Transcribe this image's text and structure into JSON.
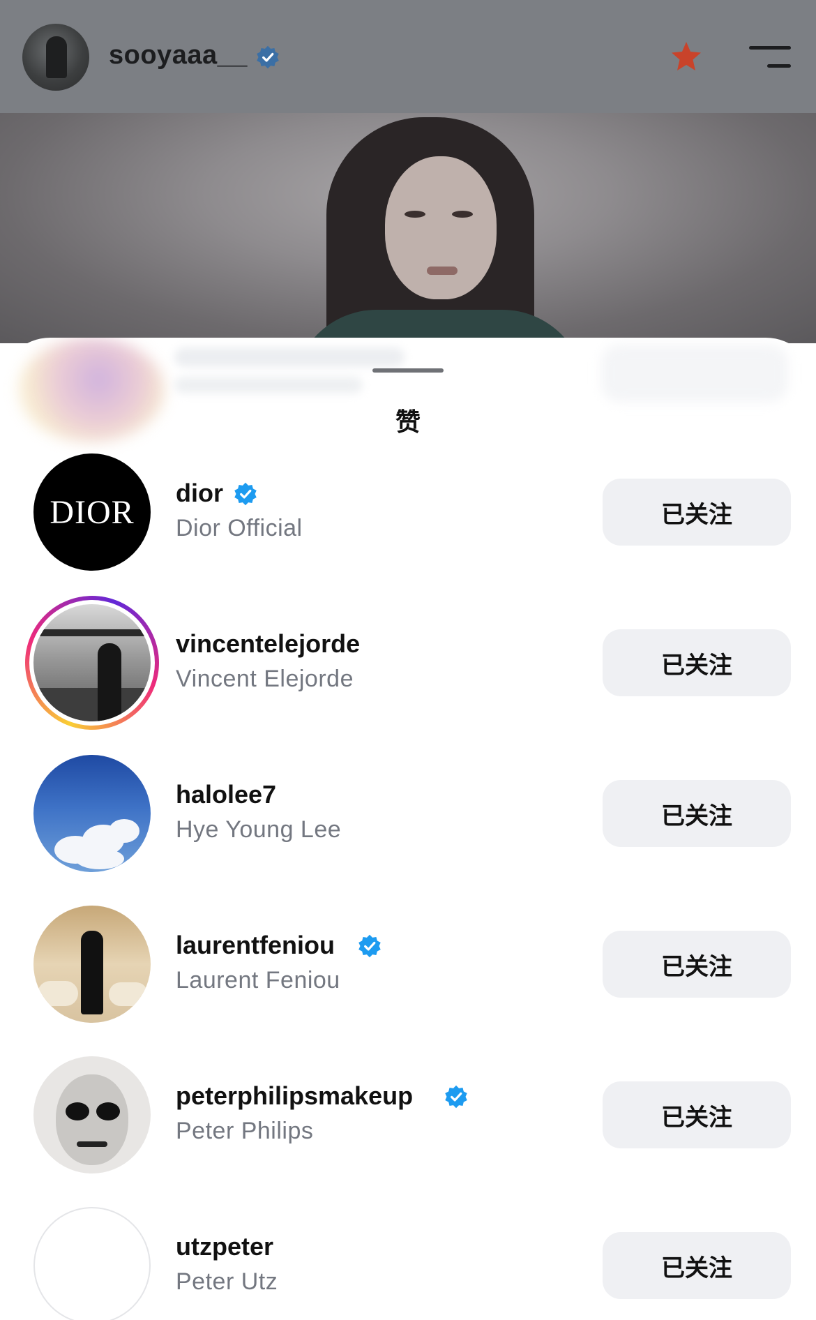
{
  "header": {
    "username": "sooyaaa__",
    "verified": true,
    "star_icon": "star-icon",
    "menu_icon": "menu-icon"
  },
  "sheet": {
    "title": "赞"
  },
  "likes": [
    {
      "username": "dior",
      "full_name": "Dior Official",
      "verified": true,
      "button": "已关注",
      "avatar": "dior-logo"
    },
    {
      "username": "vincentelejorde",
      "full_name": "Vincent Elejorde",
      "verified": false,
      "button": "已关注",
      "avatar": "story-ring"
    },
    {
      "username": "halolee7",
      "full_name": "Hye Young Lee",
      "verified": false,
      "button": "已关注",
      "avatar": "sky"
    },
    {
      "username": "laurentfeniou",
      "full_name": "Laurent Feniou",
      "verified": true,
      "button": "已关注",
      "avatar": "interior"
    },
    {
      "username": "peterphilipsmakeup",
      "full_name": "Peter Philips",
      "verified": true,
      "button": "已关注",
      "avatar": "face-portrait"
    },
    {
      "username": "utzpeter",
      "full_name": "Peter Utz",
      "verified": false,
      "button": "已关注",
      "avatar": "blank"
    }
  ],
  "colors": {
    "verified_blue": "#1d9bf0",
    "button_bg": "#eff0f3",
    "secondary_text": "#737780",
    "star": "#e8482b"
  },
  "dior_logo_text": "DIOR"
}
